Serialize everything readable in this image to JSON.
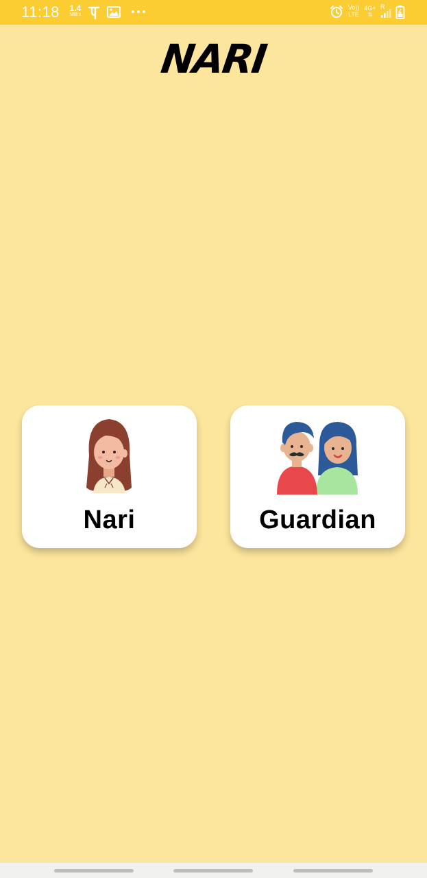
{
  "status_bar": {
    "time": "11:18",
    "net_speed_value": "1.4",
    "net_speed_unit": "MB/s",
    "network_label_top": "Vo))",
    "network_label_bottom": "LTE",
    "network_type": "4G+",
    "roaming": "R",
    "icons": [
      "phonepe-icon",
      "gallery-icon",
      "more-dots-icon",
      "alarm-icon",
      "signal-icon",
      "battery-icon"
    ],
    "background_color": "#FCCC33"
  },
  "header": {
    "title": "NARI"
  },
  "roles": [
    {
      "label": "Nari",
      "icon": "woman-avatar-icon"
    },
    {
      "label": "Guardian",
      "icon": "parents-avatar-icon"
    }
  ],
  "theme": {
    "page_background": "#FCE59C",
    "card_background": "#FFFFFF"
  }
}
